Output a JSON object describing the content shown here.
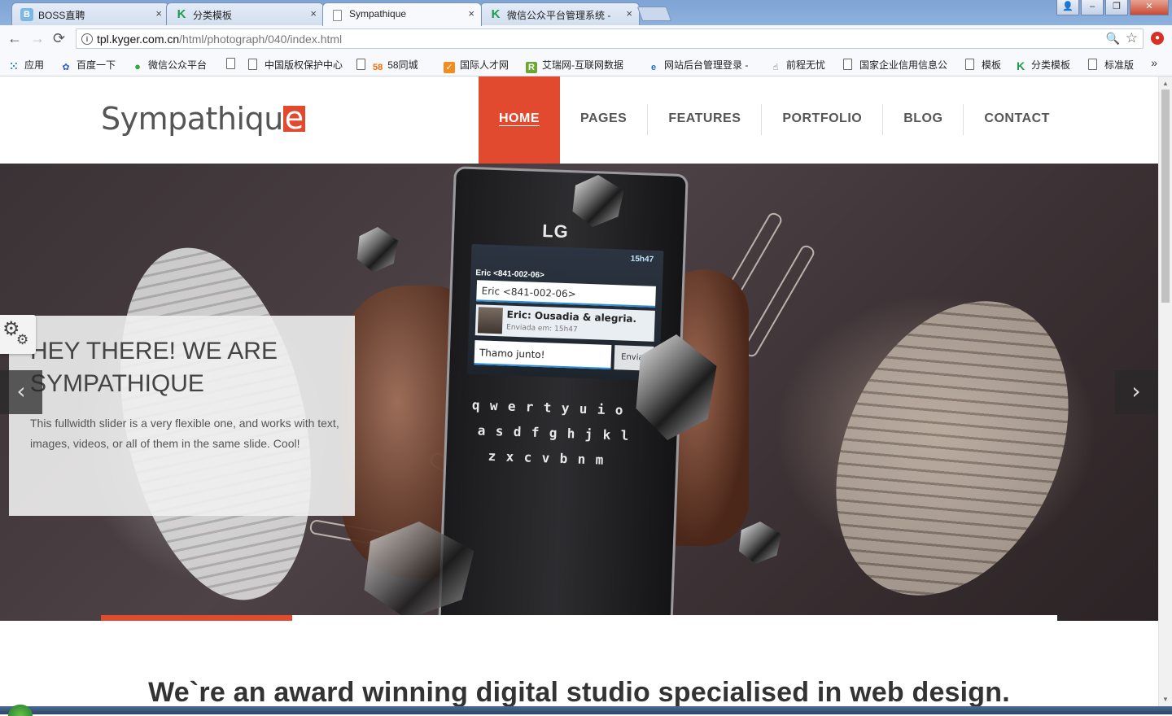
{
  "browser": {
    "tabs": [
      {
        "label": "BOSS直聘",
        "favicon": "B",
        "favicon_color": "#7cb8e6",
        "active": false
      },
      {
        "label": "分类模板",
        "favicon": "K",
        "favicon_color": "#1e9b4c",
        "active": false
      },
      {
        "label": "Sympathique",
        "favicon": "doc",
        "favicon_color": "#888888",
        "active": true
      },
      {
        "label": "微信公众平台管理系统 -",
        "favicon": "K",
        "favicon_color": "#1e9b4c",
        "active": false
      }
    ],
    "close_glyph": "×",
    "window_buttons": {
      "minimize": "–",
      "restore": "❐",
      "close": "✕",
      "user": "👤"
    },
    "nav": {
      "back": "←",
      "forward": "→",
      "reload": "⟳"
    },
    "url": {
      "host": "tpl.kyger.com.cn",
      "path": "/html/photograph/040/index.html"
    },
    "zoom_icon": "🔍",
    "star_icon": "☆",
    "bookmarks": [
      {
        "label": "应用",
        "icon": "apps-grid-icon"
      },
      {
        "label": "百度一下",
        "icon": "baidu-paw-icon"
      },
      {
        "label": "微信公众平台",
        "icon": "wechat-icon"
      },
      {
        "label": "",
        "icon": "doc-icon"
      },
      {
        "label": "中国版权保护中心",
        "icon": "doc-icon"
      },
      {
        "label": "58同城",
        "icon": "58-icon"
      },
      {
        "label": "国际人才网",
        "icon": "talent-icon"
      },
      {
        "label": "艾瑞网-互联网数据",
        "icon": "iresearch-icon"
      },
      {
        "label": "网站后台管理登录 -",
        "icon": "ie-icon"
      },
      {
        "label": "前程无忧",
        "icon": "hand-icon"
      },
      {
        "label": "国家企业信用信息公",
        "icon": "doc-icon"
      },
      {
        "label": "模板",
        "icon": "doc-icon"
      },
      {
        "label": "分类模板",
        "icon": "k-icon"
      },
      {
        "label": "标准版",
        "icon": "doc-icon"
      }
    ],
    "bookmarks_more": "»"
  },
  "site": {
    "logo_text": "Sympathiqu",
    "logo_e": "e",
    "accent": "#e14a2f",
    "nav": [
      {
        "label": "HOME",
        "active": true
      },
      {
        "label": "PAGES",
        "active": false
      },
      {
        "label": "FEATURES",
        "active": false
      },
      {
        "label": "PORTFOLIO",
        "active": false
      },
      {
        "label": "BLOG",
        "active": false
      },
      {
        "label": "CONTACT",
        "active": false
      }
    ]
  },
  "slider": {
    "title": "HEY THERE! WE ARE SYMPATHIQUE",
    "text": "This fullwidth slider is a very flexible one, and works with text, images, videos, or all of them in the same slide. Cool!",
    "prev": "‹",
    "next": "›",
    "progress": 0.2,
    "phone": {
      "brand": "LG",
      "status": "15h47",
      "contact": "Eric <841-002-06>",
      "to_field": "Eric <841-002-06>",
      "message": "Eric: Ousadia & alegria.",
      "message_time": "Enviada em: 15h47",
      "compose": "Thamo junto!",
      "send": "Enviar",
      "keyboard_rows": [
        "qwertyuio",
        "asdfghjkl",
        "zxcvbnm"
      ]
    }
  },
  "settings_icon": "gear-icon",
  "headline": "We`re an award winning digital studio specialised in web design."
}
